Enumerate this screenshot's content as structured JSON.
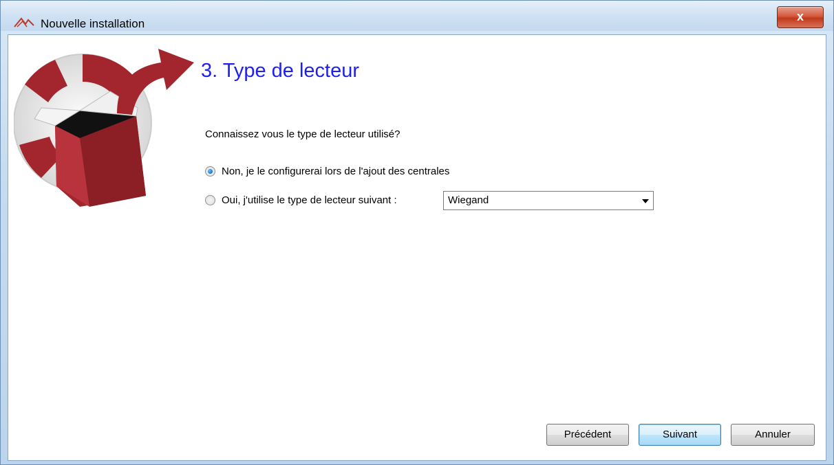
{
  "window": {
    "title": "Nouvelle installation",
    "close_label": "x"
  },
  "wizard": {
    "step_title": "3. Type de lecteur",
    "question": "Connaissez vous le type de lecteur utilisé?",
    "options": [
      {
        "label": "Non, je le configurerai lors de l'ajout des centrales",
        "checked": true
      },
      {
        "label": "Oui, j'utilise le type de lecteur suivant :",
        "checked": false
      }
    ],
    "reader_type_select": {
      "value": "Wiegand"
    }
  },
  "buttons": {
    "previous": "Précédent",
    "next": "Suivant",
    "cancel": "Annuler"
  },
  "colors": {
    "step_title": "#1f1ff0",
    "logo_red": "#a3262e",
    "close_button": "#c0391b"
  }
}
